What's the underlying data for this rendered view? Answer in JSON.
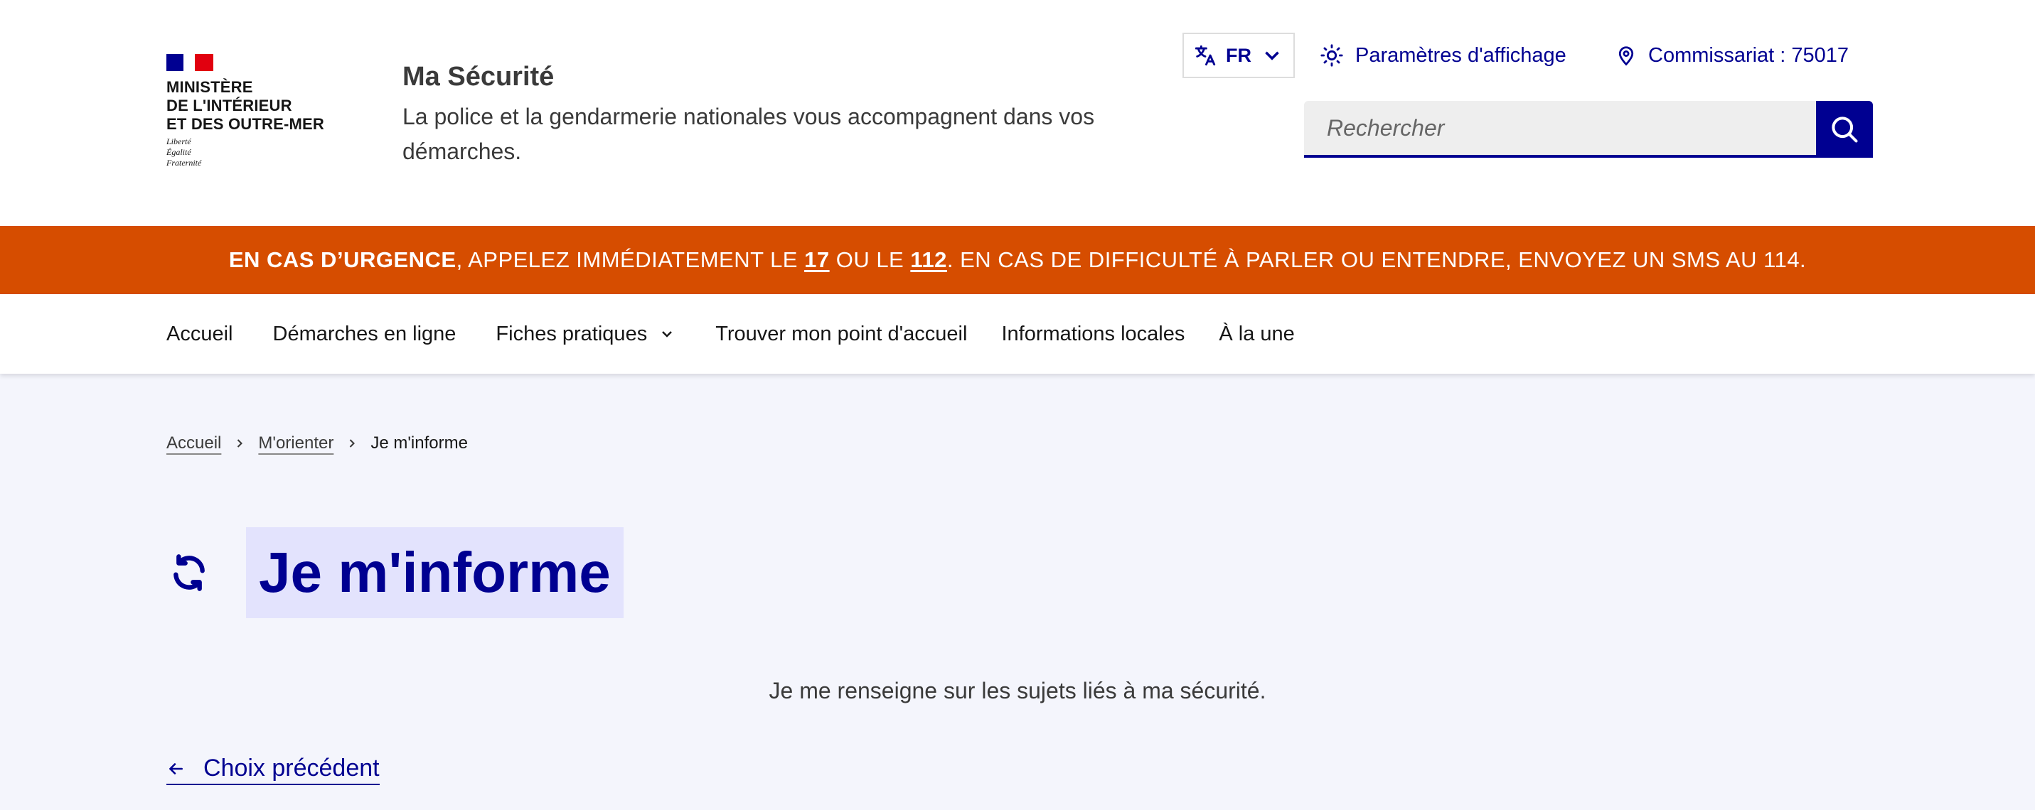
{
  "logo": {
    "line1": "MINISTÈRE",
    "line2": "DE L'INTÉRIEUR",
    "line3": "ET DES OUTRE-MER",
    "motto1": "Liberté",
    "motto2": "Égalité",
    "motto3": "Fraternité"
  },
  "brand": {
    "title": "Ma Sécurité",
    "tagline": "La police et la gendarmerie nationales vous accompagnent dans vos démarches."
  },
  "header": {
    "lang_label": "FR",
    "display_label": "Paramètres d'affichage",
    "station_label": "Commissariat : 75017",
    "search_placeholder": "Rechercher"
  },
  "alert": {
    "bold": "EN CAS D’URGENCE",
    "part1": ", APPELEZ IMMÉDIATEMENT LE ",
    "num1": "17",
    "part2": " OU LE ",
    "num2": "112",
    "part3": ". EN CAS DE DIFFICULTÉ À PARLER OU ENTENDRE, ENVOYEZ UN SMS AU 114."
  },
  "nav": {
    "items": [
      {
        "label": "Accueil"
      },
      {
        "label": "Démarches en ligne"
      },
      {
        "label": "Fiches pratiques"
      },
      {
        "label": "Trouver mon point d'accueil"
      },
      {
        "label": "Informations locales"
      },
      {
        "label": "À la une"
      }
    ]
  },
  "breadcrumb": {
    "items": [
      {
        "label": "Accueil"
      },
      {
        "label": "M'orienter"
      }
    ],
    "current": "Je m'informe"
  },
  "main": {
    "title": "Je m'informe",
    "description": "Je me renseigne sur les sujets liés à ma sécurité.",
    "back_label": "Choix précédent"
  },
  "colors": {
    "primary": "#000091",
    "alert": "#d64d00",
    "page_bg": "#f4f5fc",
    "title_highlight": "#e3e3fd"
  }
}
